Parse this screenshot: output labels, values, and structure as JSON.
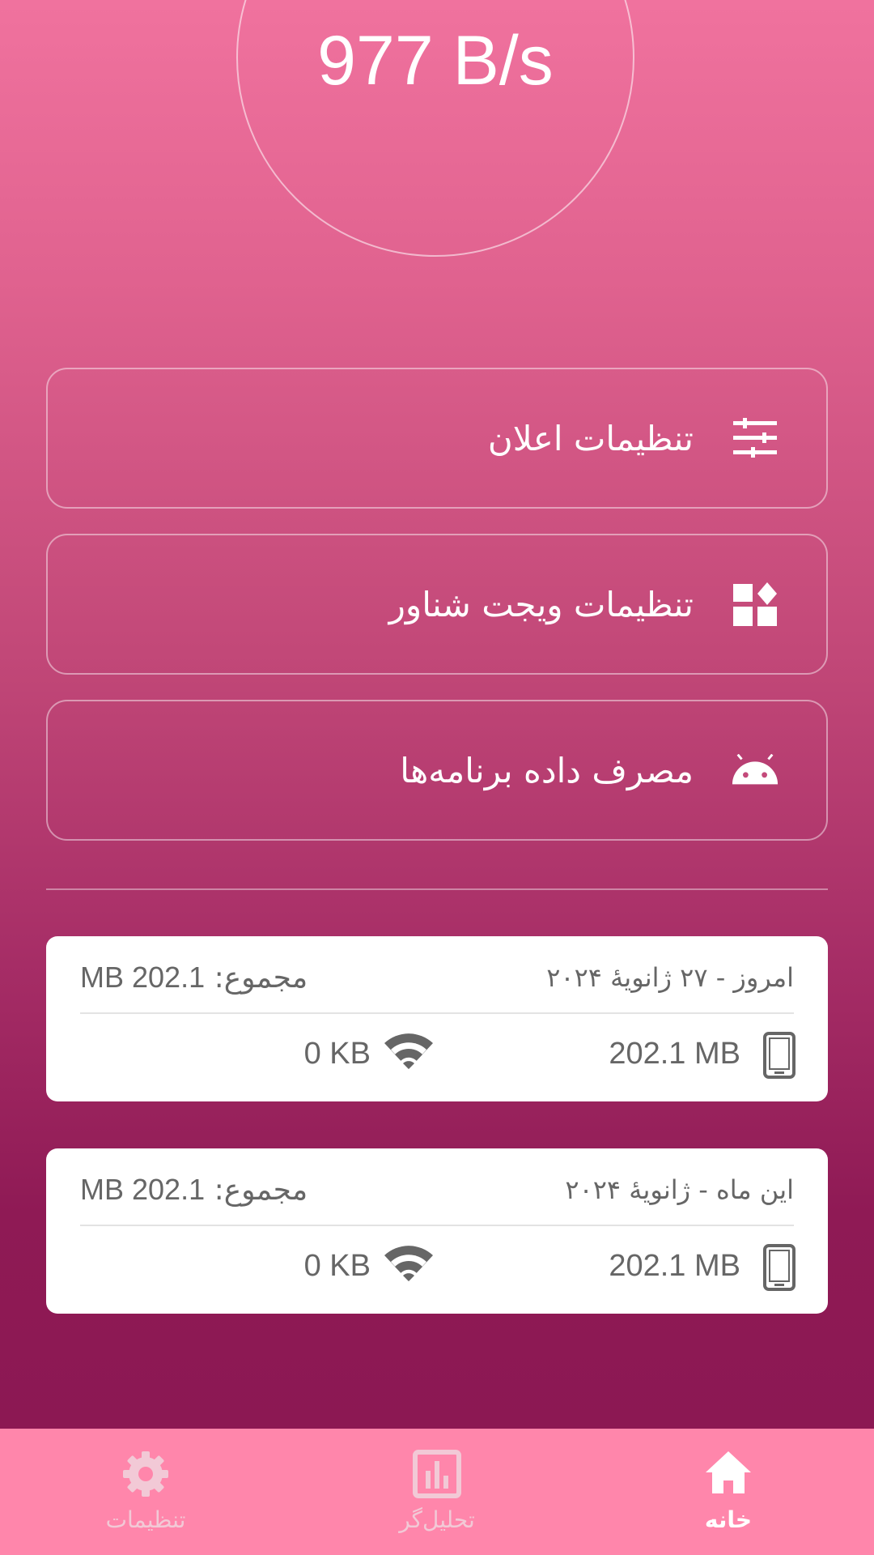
{
  "speed": {
    "value": "977 B/s"
  },
  "menu": [
    {
      "label": "تنظیمات اعلان",
      "icon": "tune-sliders-icon"
    },
    {
      "label": "تنظیمات ویجت شناور",
      "icon": "widgets-icon"
    },
    {
      "label": "مصرف داده برنامه‌ها",
      "icon": "android-icon"
    }
  ],
  "usage_cards": [
    {
      "date": "امروز - ۲۷ ژانویهٔ ۲۰۲۴",
      "total_label": "مجموع:",
      "total_value": "202.1 MB",
      "mobile_value": "202.1 MB",
      "wifi_value": "0 KB"
    },
    {
      "date": "این ماه - ژانویهٔ ۲۰۲۴",
      "total_label": "مجموع:",
      "total_value": "202.1 MB",
      "mobile_value": "202.1 MB",
      "wifi_value": "0 KB"
    }
  ],
  "bottom_nav": {
    "items": [
      {
        "label": "تنظیمات",
        "icon": "gear-icon",
        "active": false
      },
      {
        "label": "تحلیل‌گر",
        "icon": "bar-chart-icon",
        "active": false
      },
      {
        "label": "خانه",
        "icon": "home-icon",
        "active": true
      }
    ]
  },
  "colors": {
    "gradient_top": "#f0729e",
    "gradient_bottom": "#8a1752",
    "nav_background": "#ff86ab",
    "card_text": "#666666",
    "nav_inactive": "#f2c9d6"
  }
}
